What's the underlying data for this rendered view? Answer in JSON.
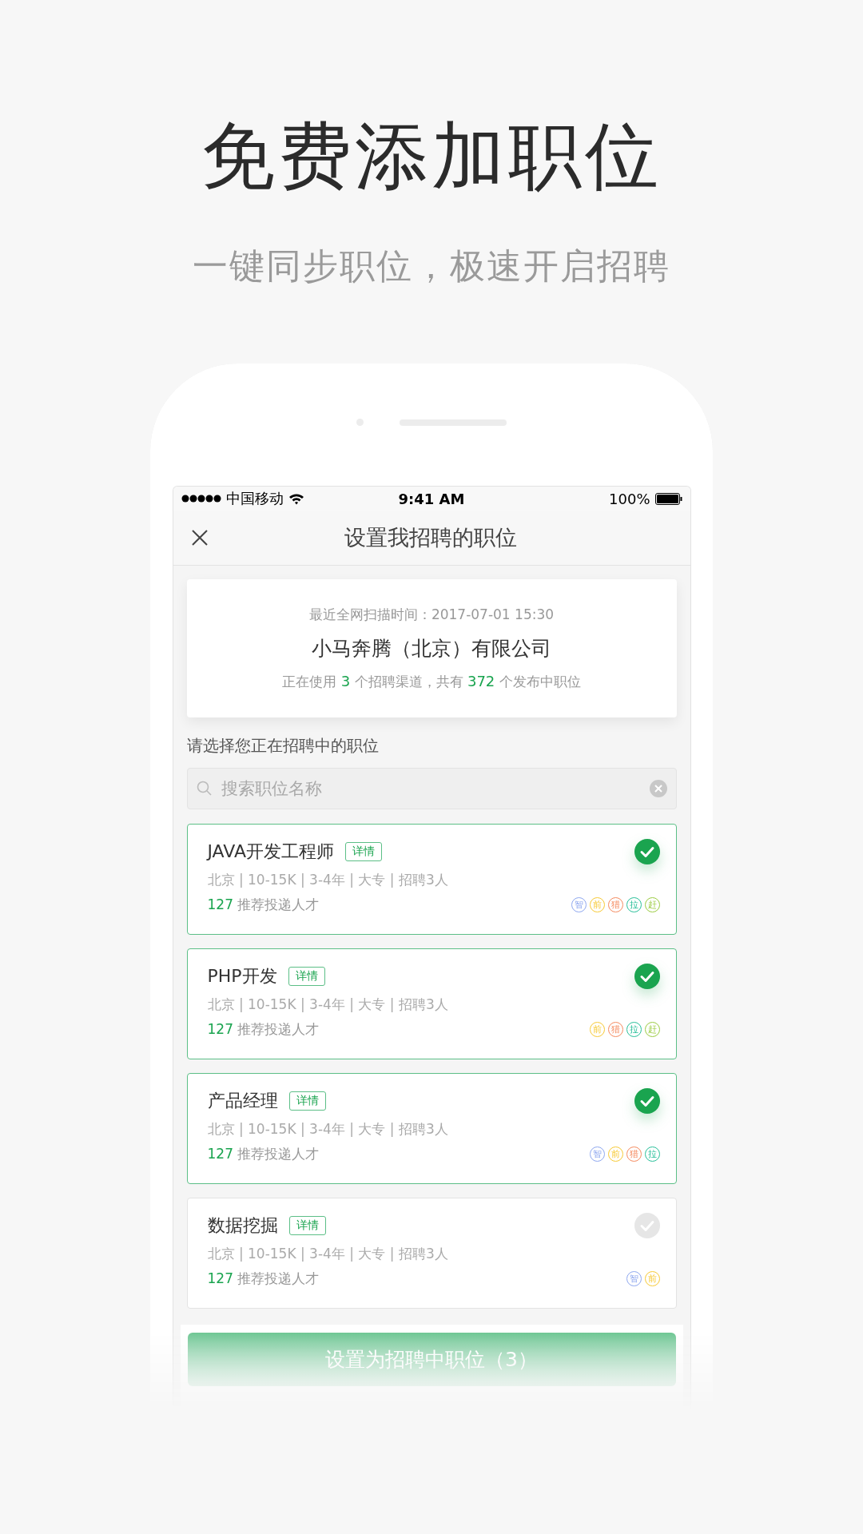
{
  "heading": "免费添加职位",
  "subheading": "一键同步职位，极速开启招聘",
  "status_bar": {
    "carrier": "中国移动",
    "time": "9:41 AM",
    "battery": "100%"
  },
  "nav": {
    "title": "设置我招聘的职位"
  },
  "summary": {
    "scan_time": "最近全网扫描时间：2017-07-01 15:30",
    "company": "小马奔腾（北京）有限公司",
    "stats": [
      {
        "text": "正在使用 ",
        "highlight": false
      },
      {
        "text": "3",
        "highlight": true
      },
      {
        "text": " 个招聘渠道，共有 ",
        "highlight": false
      },
      {
        "text": "372",
        "highlight": true
      },
      {
        "text": " 个发布中职位",
        "highlight": false
      }
    ]
  },
  "prompt": "请选择您正在招聘中的职位",
  "search": {
    "placeholder": "搜索职位名称"
  },
  "jobs": [
    {
      "title": "JAVA开发工程师",
      "detail_label": "详情",
      "meta": "北京 | 10-15K | 3-4年 | 大专 | 招聘3人",
      "count": "127",
      "count_label": "推荐投递人才",
      "selected": true,
      "channels": [
        {
          "label": "智",
          "color": "#8ea7ef"
        },
        {
          "label": "前",
          "color": "#f7c933"
        },
        {
          "label": "猎",
          "color": "#f58a5e"
        },
        {
          "label": "拉",
          "color": "#27bf99"
        },
        {
          "label": "赶",
          "color": "#9acb3f"
        }
      ]
    },
    {
      "title": "PHP开发",
      "detail_label": "详情",
      "meta": "北京 | 10-15K | 3-4年 | 大专 | 招聘3人",
      "count": "127",
      "count_label": "推荐投递人才",
      "selected": true,
      "channels": [
        {
          "label": "前",
          "color": "#f7c933"
        },
        {
          "label": "猎",
          "color": "#f58a5e"
        },
        {
          "label": "拉",
          "color": "#27bf99"
        },
        {
          "label": "赶",
          "color": "#9acb3f"
        }
      ]
    },
    {
      "title": "产品经理",
      "detail_label": "详情",
      "meta": "北京 | 10-15K | 3-4年 | 大专 | 招聘3人",
      "count": "127",
      "count_label": "推荐投递人才",
      "selected": true,
      "channels": [
        {
          "label": "智",
          "color": "#8ea7ef"
        },
        {
          "label": "前",
          "color": "#f7c933"
        },
        {
          "label": "猎",
          "color": "#f58a5e"
        },
        {
          "label": "拉",
          "color": "#27bf99"
        }
      ]
    },
    {
      "title": "数据挖掘",
      "detail_label": "详情",
      "meta": "北京 | 10-15K | 3-4年 | 大专 | 招聘3人",
      "count": "127",
      "count_label": "推荐投递人才",
      "selected": false,
      "channels": [
        {
          "label": "智",
          "color": "#8ea7ef"
        },
        {
          "label": "前",
          "color": "#f7c933"
        }
      ]
    }
  ],
  "submit": {
    "label": "设置为招聘中职位（3）"
  }
}
